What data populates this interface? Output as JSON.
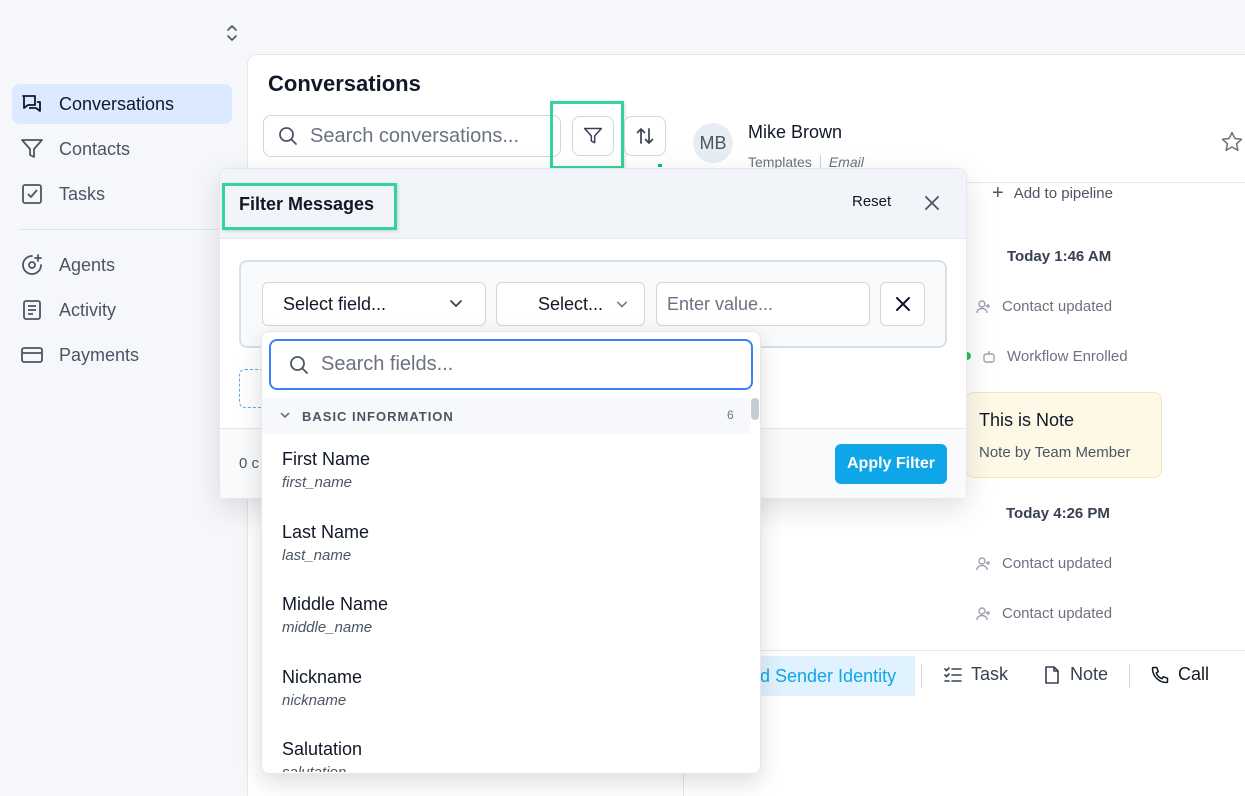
{
  "sidebar": {
    "items": [
      {
        "label": "Conversations",
        "icon": "chat-bubbles-icon",
        "active": true
      },
      {
        "label": "Contacts",
        "icon": "funnel-icon"
      },
      {
        "label": "Tasks",
        "icon": "check-square-icon"
      },
      {
        "label": "Agents",
        "icon": "sparkle-agent-icon"
      },
      {
        "label": "Activity",
        "icon": "document-list-icon"
      },
      {
        "label": "Payments",
        "icon": "credit-card-icon"
      }
    ]
  },
  "conversations": {
    "title": "Conversations",
    "search_placeholder": "Search conversations..."
  },
  "contact": {
    "initials": "MB",
    "name": "Mike Brown",
    "templates": "Templates",
    "channel": "Email",
    "add_pipeline": "Add to pipeline"
  },
  "timeline": {
    "time1": "Today 1:46 AM",
    "event1": "Contact updated",
    "event2": "Workflow Enrolled",
    "note_title": "This is Note",
    "note_sub": "Note by Team Member",
    "time2": "Today 4:26 PM",
    "event3": "Contact updated",
    "event4": "Contact updated"
  },
  "bottom_bar": {
    "sender_identity": "d Sender Identity",
    "task": "Task",
    "note": "Note",
    "call": "Call"
  },
  "filter_modal": {
    "title": "Filter Messages",
    "reset": "Reset",
    "field_placeholder": "Select field...",
    "operator_placeholder": "Select...",
    "value_placeholder": "Enter value...",
    "count_text": "0 c",
    "apply": "Apply Filter"
  },
  "field_dropdown": {
    "search_placeholder": "Search fields...",
    "group_label": "BASIC INFORMATION",
    "group_count": "6",
    "fields": [
      {
        "label": "First Name",
        "key": "first_name"
      },
      {
        "label": "Last Name",
        "key": "last_name"
      },
      {
        "label": "Middle Name",
        "key": "middle_name"
      },
      {
        "label": "Nickname",
        "key": "nickname"
      },
      {
        "label": "Salutation",
        "key": "salutation"
      }
    ]
  },
  "colors": {
    "accent": "#0ea5e9",
    "highlight": "#34d399",
    "active_nav": "#dbeafe"
  }
}
